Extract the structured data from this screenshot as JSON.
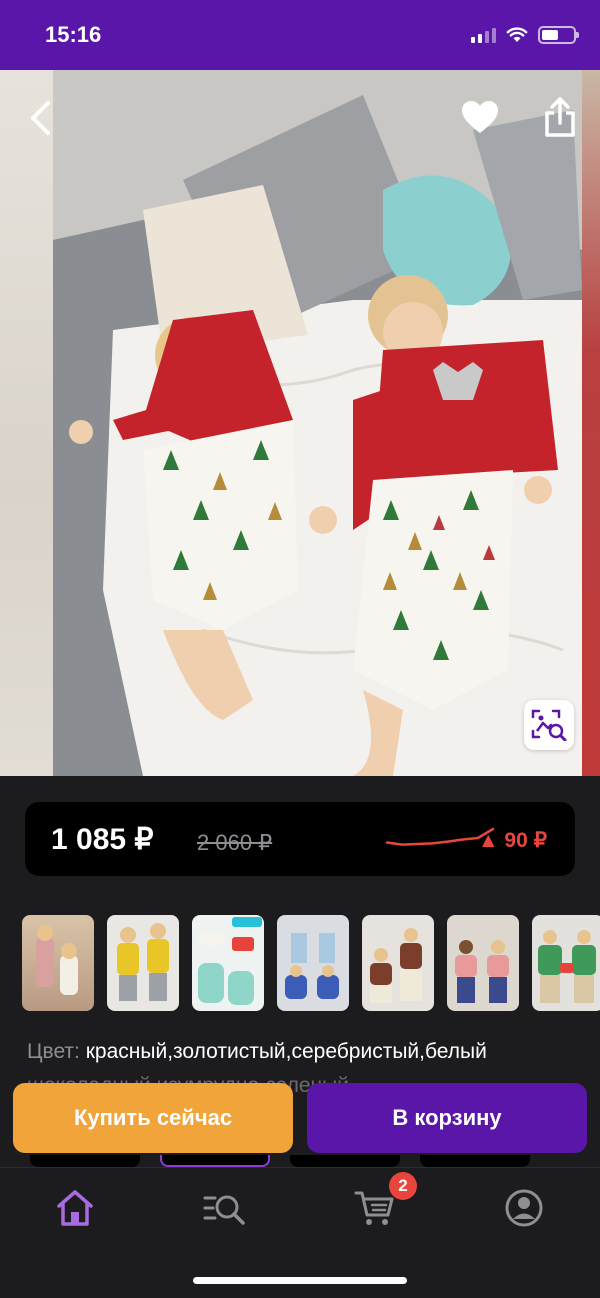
{
  "status": {
    "time": "15:16"
  },
  "product": {
    "price_current": "1 085 ₽",
    "price_old": "2 060 ₽",
    "price_delta": "▲ 90 ₽",
    "color_label": "Цвет:",
    "color_value": "красный,золотистый,серебристый,белый",
    "color_value_line2": "шоколадный,изумрудно-зеленый"
  },
  "actions": {
    "buy_now": "Купить сейчас",
    "add_to_cart": "В корзину"
  },
  "cart_badge": "2",
  "colors": {
    "brand_purple": "#5a16a8",
    "buy_orange": "#f0a43a",
    "price_red": "#e8453c",
    "tab_active": "#a86be0"
  },
  "price_trend": [
    0.55,
    0.62,
    0.6,
    0.58,
    0.52,
    0.45,
    0.4,
    0.1
  ]
}
